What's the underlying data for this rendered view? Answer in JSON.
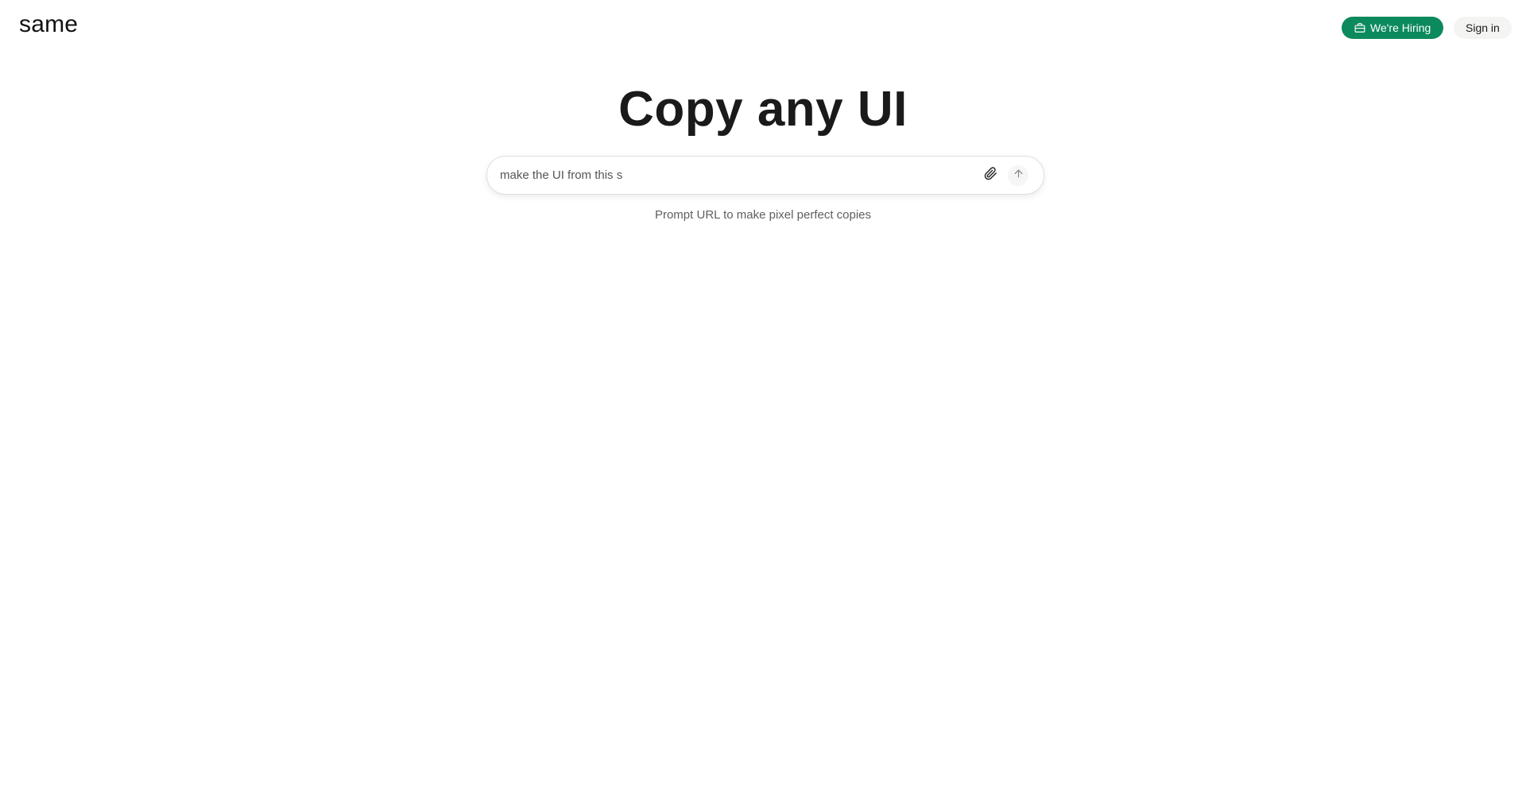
{
  "header": {
    "logo_text": "same",
    "hiring_label": "We're Hiring",
    "hiring_icon": "briefcase-icon",
    "signin_label": "Sign in"
  },
  "hero": {
    "title": "Copy any UI"
  },
  "prompt": {
    "value": "make the UI from this s",
    "attach_icon": "paperclip-icon",
    "send_icon": "arrow-up-icon"
  },
  "hint": {
    "text": "Prompt URL to make pixel perfect copies"
  },
  "colors": {
    "accent": "#0b8a5e",
    "background": "#ffffff",
    "text": "#1a1a1a"
  }
}
